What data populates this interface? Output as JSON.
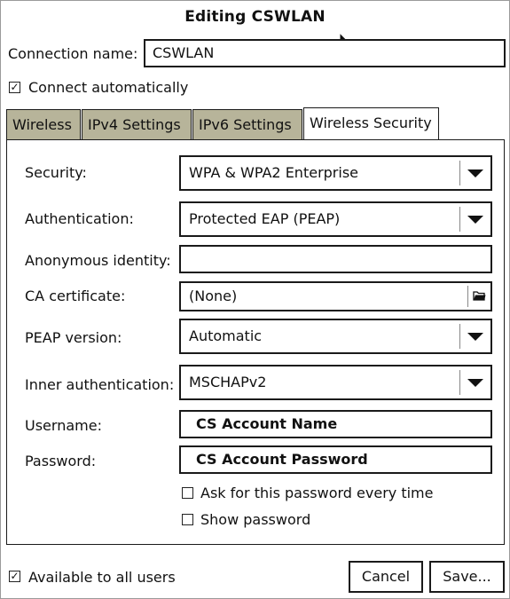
{
  "window": {
    "title": "Editing CSWLAN"
  },
  "connection": {
    "name_label": "Connection name:",
    "name_value": "CSWLAN"
  },
  "connect_auto": {
    "label": "Connect automatically",
    "checked": true
  },
  "tabs": [
    {
      "label": "Wireless",
      "active": false
    },
    {
      "label": "IPv4 Settings",
      "active": false
    },
    {
      "label": "IPv6 Settings",
      "active": false
    },
    {
      "label": "Wireless Security",
      "active": true
    }
  ],
  "security_form": {
    "security": {
      "label": "Security:",
      "value": "WPA & WPA2 Enterprise"
    },
    "authentication": {
      "label": "Authentication:",
      "value": "Protected EAP (PEAP)"
    },
    "anonymous_identity": {
      "label": "Anonymous identity:",
      "value": ""
    },
    "ca_certificate": {
      "label": "CA certificate:",
      "value": "(None)"
    },
    "peap_version": {
      "label": "PEAP version:",
      "value": "Automatic"
    },
    "inner_auth": {
      "label": "Inner authentication:",
      "value": "MSCHAPv2"
    },
    "username": {
      "label": "Username:",
      "value": "CS Account Name"
    },
    "password": {
      "label": "Password:",
      "value": "CS Account Password"
    },
    "ask_password": {
      "label": "Ask for this password every time",
      "checked": false
    },
    "show_password": {
      "label": "Show password",
      "checked": false
    }
  },
  "footer": {
    "all_users": {
      "label": "Available to all users",
      "checked": true
    },
    "cancel_label": "Cancel",
    "save_label": "Save..."
  },
  "icons": {
    "combo_arrow": "triangle-down-icon",
    "file_chooser": "folder-icon",
    "checkmark": "check-icon",
    "cursor": "mouse-pointer-icon"
  },
  "colors": {
    "inactive_tab": "#b7b49a",
    "border": "#1a1a1a",
    "background": "#ffffff"
  }
}
